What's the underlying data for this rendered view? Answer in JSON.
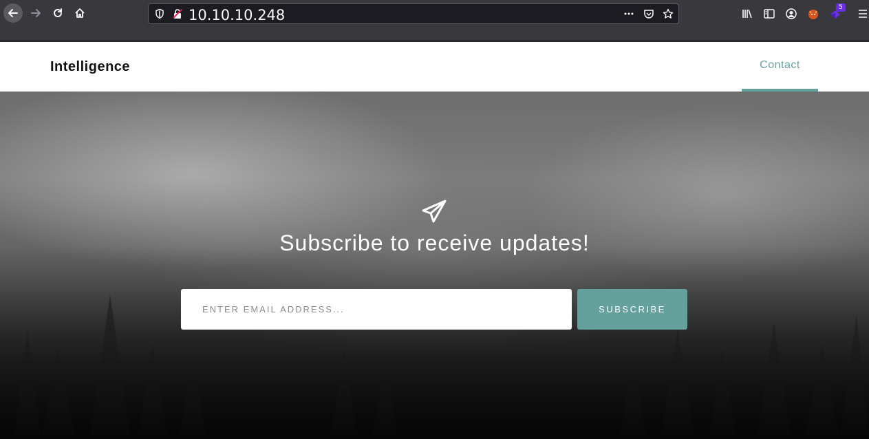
{
  "browser": {
    "url": "10.10.10.248",
    "extension_badge": "5"
  },
  "site": {
    "brand": "Intelligence",
    "nav": {
      "contact_label": "Contact"
    }
  },
  "hero": {
    "headline": "Subscribe to receive updates!",
    "email_placeholder": "ENTER EMAIL ADDRESS...",
    "subscribe_label": "SUBSCRIBE"
  },
  "colors": {
    "accent": "#64a19d"
  }
}
